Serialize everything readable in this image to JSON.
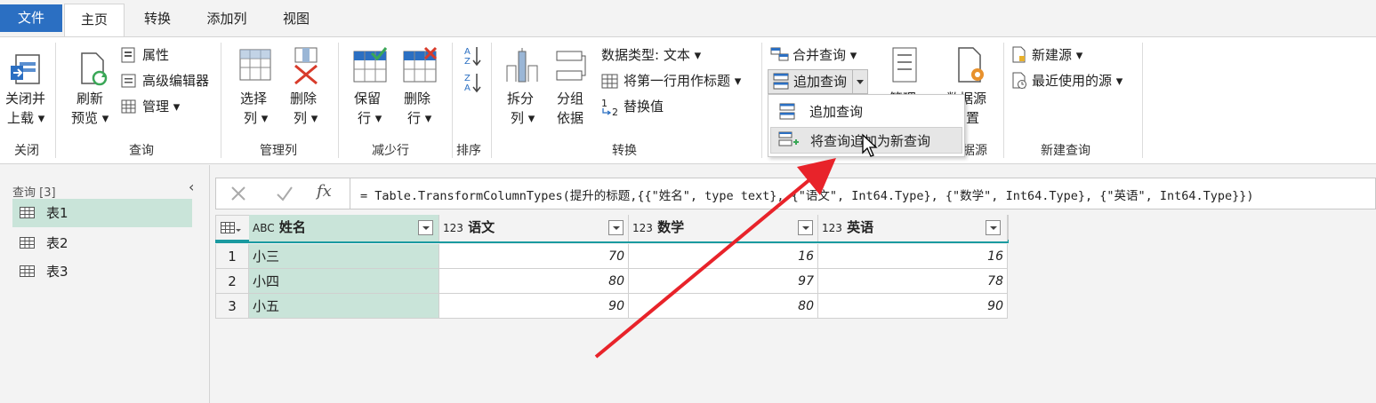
{
  "tabs": {
    "file": "文件",
    "home": "主页",
    "transform": "转换",
    "add_column": "添加列",
    "view": "视图"
  },
  "ribbon": {
    "close": {
      "close_load_1": "关闭并",
      "close_load_2": "上载 ▾",
      "group_label": "关闭"
    },
    "query": {
      "refresh_1": "刷新",
      "refresh_2": "预览 ▾",
      "properties": "属性",
      "advanced_editor": "高级编辑器",
      "manage": "管理 ▾",
      "group_label": "查询"
    },
    "manage_columns": {
      "choose_1": "选择",
      "choose_2": "列 ▾",
      "remove_1": "删除",
      "remove_2": "列 ▾",
      "group_label": "管理列"
    },
    "reduce_rows": {
      "keep_1": "保留",
      "keep_2": "行 ▾",
      "remove_1": "删除",
      "remove_2": "行 ▾",
      "group_label": "减少行"
    },
    "sort": {
      "group_label": "排序"
    },
    "transform": {
      "split_1": "拆分",
      "split_2": "列 ▾",
      "group_1": "分组",
      "group_2": "依据",
      "data_type": "数据类型: 文本 ▾",
      "first_row_header": "将第一行用作标题 ▾",
      "replace_values": "替换值",
      "group_label": "转换"
    },
    "combine": {
      "merge_queries": "合并查询 ▾",
      "append_queries": "追加查询",
      "manage_params_partial": "管理",
      "group_label_partial": "据源"
    },
    "data_source": {
      "settings_1": "数据源",
      "settings_2": "置"
    },
    "new_query": {
      "new_source": "新建源 ▾",
      "recent_sources": "最近使用的源 ▾",
      "group_label": "新建查询"
    }
  },
  "append_menu": {
    "items": [
      "追加查询",
      "将查询追加为新查询"
    ],
    "highlighted_index": 1
  },
  "queries_pane": {
    "title": "查询 [3]",
    "items": [
      "表1",
      "表2",
      "表3"
    ],
    "selected_index": 0
  },
  "formula_bar": {
    "fx": "fx",
    "formula": "= Table.TransformColumnTypes(提升的标题,{{\"姓名\", type text}, {\"语文\", Int64.Type}, {\"数学\", Int64.Type}, {\"英语\", Int64.Type}})"
  },
  "table": {
    "columns": [
      {
        "type_icon": "ABC",
        "name": "姓名"
      },
      {
        "type_icon": "123",
        "name": "语文"
      },
      {
        "type_icon": "123",
        "name": "数学"
      },
      {
        "type_icon": "123",
        "name": "英语"
      }
    ],
    "rows": [
      {
        "index": "1",
        "cells": [
          "小三",
          "70",
          "16",
          "16"
        ]
      },
      {
        "index": "2",
        "cells": [
          "小四",
          "80",
          "97",
          "78"
        ]
      },
      {
        "index": "3",
        "cells": [
          "小五",
          "90",
          "80",
          "90"
        ]
      }
    ]
  },
  "colors": {
    "file_tab": "#2b6fc2",
    "selected_column": "#c9e4d9",
    "header_accent": "#1a9aa0",
    "annotation_arrow": "#e8232a"
  }
}
